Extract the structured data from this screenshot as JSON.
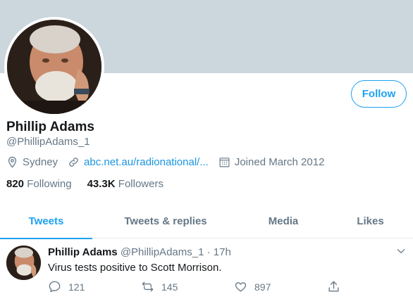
{
  "profile": {
    "name": "Phillip Adams",
    "handle": "@PhillipAdams_1",
    "location": "Sydney",
    "website": "abc.net.au/radionational/...",
    "joined": "Joined March 2012",
    "following_count": "820",
    "following_label": "Following",
    "followers_count": "43.3K",
    "followers_label": "Followers",
    "follow_label": "Follow"
  },
  "tabs": [
    {
      "label": "Tweets",
      "active": true
    },
    {
      "label": "Tweets & replies",
      "active": false
    },
    {
      "label": "Media",
      "active": false
    },
    {
      "label": "Likes",
      "active": false
    }
  ],
  "tweet": {
    "name": "Phillip Adams",
    "handle": "@PhillipAdams_1",
    "separator": "·",
    "time": "17h",
    "text": "Virus tests positive to Scott Morrison.",
    "replies": "121",
    "retweets": "145",
    "likes": "897"
  },
  "colors": {
    "accent": "#1da1f2",
    "banner": "#ccd6dd",
    "muted": "#657786",
    "link": "#1b95e0"
  },
  "icons": [
    "location-icon",
    "link-icon",
    "calendar-icon",
    "chevron-down-icon",
    "reply-icon",
    "retweet-icon",
    "like-icon",
    "share-icon"
  ]
}
